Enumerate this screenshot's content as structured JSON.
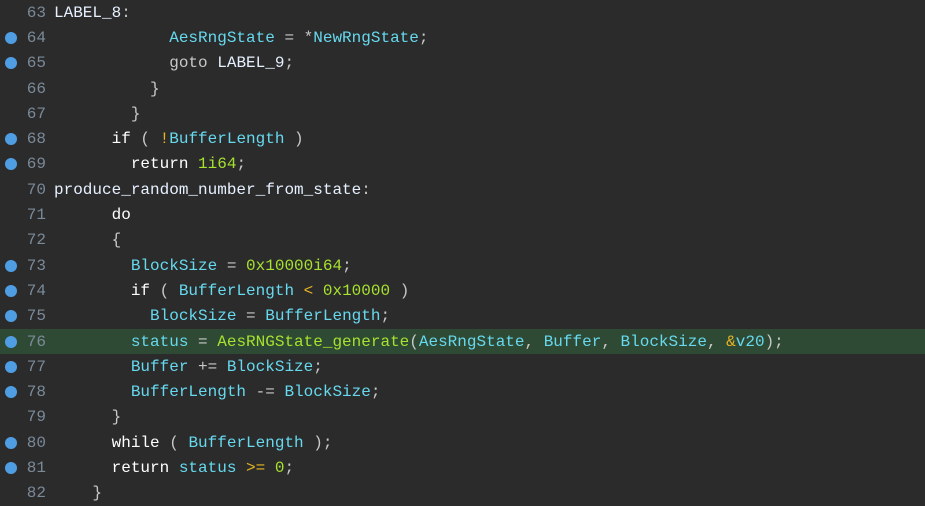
{
  "colors": {
    "background": "#2b2b2b",
    "gutter_number": "#7a8a99",
    "breakpoint": "#4f9ee3",
    "highlight_line_bg": "#2f4a34",
    "identifier": "#66d9ef",
    "function": "#a6e22e",
    "number": "#a6e22e",
    "operator": "#e6b422",
    "default_text": "#c8c8c8"
  },
  "highlighted_line": 76,
  "lines": [
    {
      "n": 63,
      "bp": false,
      "tokens": [
        {
          "t": "LABEL_8",
          "c": "label"
        },
        {
          "t": ":",
          "c": "punct"
        }
      ]
    },
    {
      "n": 64,
      "bp": true,
      "tokens": [
        {
          "t": "            ",
          "c": "default"
        },
        {
          "t": "AesRngState",
          "c": "ident"
        },
        {
          "t": " = *",
          "c": "default"
        },
        {
          "t": "NewRngState",
          "c": "ident"
        },
        {
          "t": ";",
          "c": "punct"
        }
      ]
    },
    {
      "n": 65,
      "bp": true,
      "tokens": [
        {
          "t": "            ",
          "c": "default"
        },
        {
          "t": "goto",
          "c": "default"
        },
        {
          "t": " ",
          "c": "default"
        },
        {
          "t": "LABEL_9",
          "c": "label"
        },
        {
          "t": ";",
          "c": "punct"
        }
      ]
    },
    {
      "n": 66,
      "bp": false,
      "tokens": [
        {
          "t": "          }",
          "c": "default"
        }
      ]
    },
    {
      "n": 67,
      "bp": false,
      "tokens": [
        {
          "t": "        }",
          "c": "default"
        }
      ]
    },
    {
      "n": 68,
      "bp": true,
      "tokens": [
        {
          "t": "      ",
          "c": "default"
        },
        {
          "t": "if",
          "c": "kwflow"
        },
        {
          "t": " ( ",
          "c": "default"
        },
        {
          "t": "!",
          "c": "op"
        },
        {
          "t": "BufferLength",
          "c": "ident"
        },
        {
          "t": " )",
          "c": "default"
        }
      ]
    },
    {
      "n": 69,
      "bp": true,
      "tokens": [
        {
          "t": "        ",
          "c": "default"
        },
        {
          "t": "return",
          "c": "kwflow"
        },
        {
          "t": " ",
          "c": "default"
        },
        {
          "t": "1i64",
          "c": "num"
        },
        {
          "t": ";",
          "c": "punct"
        }
      ]
    },
    {
      "n": 70,
      "bp": false,
      "tokens": [
        {
          "t": "produce_random_number_from_state",
          "c": "label"
        },
        {
          "t": ":",
          "c": "punct"
        }
      ]
    },
    {
      "n": 71,
      "bp": false,
      "tokens": [
        {
          "t": "      ",
          "c": "default"
        },
        {
          "t": "do",
          "c": "kwflow"
        }
      ]
    },
    {
      "n": 72,
      "bp": false,
      "tokens": [
        {
          "t": "      {",
          "c": "default"
        }
      ]
    },
    {
      "n": 73,
      "bp": true,
      "tokens": [
        {
          "t": "        ",
          "c": "default"
        },
        {
          "t": "BlockSize",
          "c": "ident"
        },
        {
          "t": " = ",
          "c": "default"
        },
        {
          "t": "0x10000i64",
          "c": "num"
        },
        {
          "t": ";",
          "c": "punct"
        }
      ]
    },
    {
      "n": 74,
      "bp": true,
      "tokens": [
        {
          "t": "        ",
          "c": "default"
        },
        {
          "t": "if",
          "c": "kwflow"
        },
        {
          "t": " ( ",
          "c": "default"
        },
        {
          "t": "BufferLength",
          "c": "ident"
        },
        {
          "t": " ",
          "c": "default"
        },
        {
          "t": "<",
          "c": "op"
        },
        {
          "t": " ",
          "c": "default"
        },
        {
          "t": "0x10000",
          "c": "num"
        },
        {
          "t": " )",
          "c": "default"
        }
      ]
    },
    {
      "n": 75,
      "bp": true,
      "tokens": [
        {
          "t": "          ",
          "c": "default"
        },
        {
          "t": "BlockSize",
          "c": "ident"
        },
        {
          "t": " = ",
          "c": "default"
        },
        {
          "t": "BufferLength",
          "c": "ident"
        },
        {
          "t": ";",
          "c": "punct"
        }
      ]
    },
    {
      "n": 76,
      "bp": true,
      "tokens": [
        {
          "t": "        ",
          "c": "default"
        },
        {
          "t": "status",
          "c": "ident"
        },
        {
          "t": " = ",
          "c": "default"
        },
        {
          "t": "AesRNGState_generate",
          "c": "func"
        },
        {
          "t": "(",
          "c": "default"
        },
        {
          "t": "AesRngState",
          "c": "ident"
        },
        {
          "t": ", ",
          "c": "default"
        },
        {
          "t": "Buffer",
          "c": "ident"
        },
        {
          "t": ", ",
          "c": "default"
        },
        {
          "t": "BlockSize",
          "c": "ident"
        },
        {
          "t": ", ",
          "c": "default"
        },
        {
          "t": "&",
          "c": "op"
        },
        {
          "t": "v20",
          "c": "ident"
        },
        {
          "t": ");",
          "c": "default"
        }
      ]
    },
    {
      "n": 77,
      "bp": true,
      "tokens": [
        {
          "t": "        ",
          "c": "default"
        },
        {
          "t": "Buffer",
          "c": "ident"
        },
        {
          "t": " += ",
          "c": "default"
        },
        {
          "t": "BlockSize",
          "c": "ident"
        },
        {
          "t": ";",
          "c": "punct"
        }
      ]
    },
    {
      "n": 78,
      "bp": true,
      "tokens": [
        {
          "t": "        ",
          "c": "default"
        },
        {
          "t": "BufferLength",
          "c": "ident"
        },
        {
          "t": " -= ",
          "c": "default"
        },
        {
          "t": "BlockSize",
          "c": "ident"
        },
        {
          "t": ";",
          "c": "punct"
        }
      ]
    },
    {
      "n": 79,
      "bp": false,
      "tokens": [
        {
          "t": "      }",
          "c": "default"
        }
      ]
    },
    {
      "n": 80,
      "bp": true,
      "tokens": [
        {
          "t": "      ",
          "c": "default"
        },
        {
          "t": "while",
          "c": "kwflow"
        },
        {
          "t": " ( ",
          "c": "default"
        },
        {
          "t": "BufferLength",
          "c": "ident"
        },
        {
          "t": " );",
          "c": "default"
        }
      ]
    },
    {
      "n": 81,
      "bp": true,
      "tokens": [
        {
          "t": "      ",
          "c": "default"
        },
        {
          "t": "return",
          "c": "kwflow"
        },
        {
          "t": " ",
          "c": "default"
        },
        {
          "t": "status",
          "c": "ident"
        },
        {
          "t": " ",
          "c": "default"
        },
        {
          "t": ">=",
          "c": "op"
        },
        {
          "t": " ",
          "c": "default"
        },
        {
          "t": "0",
          "c": "num"
        },
        {
          "t": ";",
          "c": "punct"
        }
      ]
    },
    {
      "n": 82,
      "bp": false,
      "tokens": [
        {
          "t": "    }",
          "c": "default"
        }
      ]
    }
  ]
}
